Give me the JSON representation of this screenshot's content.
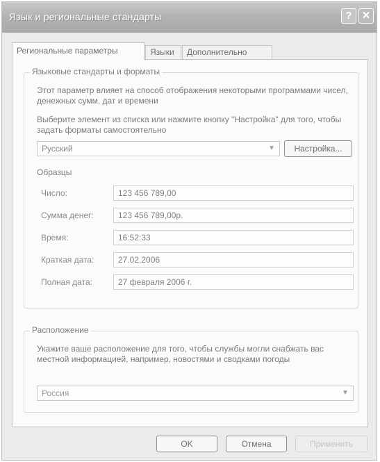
{
  "window": {
    "title": "Язык и региональные стандарты",
    "help_glyph": "?",
    "close_glyph": "✕"
  },
  "tabs": [
    {
      "label": "Региональные параметры"
    },
    {
      "label": "Языки"
    },
    {
      "label": "Дополнительно"
    }
  ],
  "standards": {
    "legend": "Языковые стандарты и форматы",
    "description": "Этот параметр влияет на способ отображения некоторыми программами чисел, денежных сумм, дат и времени",
    "instruction": "Выберите элемент из списка или нажмите кнопку \"Настройка\" для того, чтобы задать форматы самостоятельно",
    "selected_locale": "Русский",
    "customize_button": "Настройка..."
  },
  "samples": {
    "legend": "Образцы",
    "rows": [
      {
        "label": "Число:",
        "value": "123 456 789,00"
      },
      {
        "label": "Сумма денег:",
        "value": "123 456 789,00р."
      },
      {
        "label": "Время:",
        "value": "16:52:33"
      },
      {
        "label": "Краткая дата:",
        "value": "27.02.2006"
      },
      {
        "label": "Полная дата:",
        "value": "27 февраля 2006 г."
      }
    ]
  },
  "location": {
    "legend": "Расположение",
    "description": "Укажите ваше расположение для того, чтобы службы могли снабжать вас местной информацией, например, новостями и сводками погоды",
    "selected_location": "Россия"
  },
  "footer": {
    "ok_button": "OK",
    "cancel_button": "Отмена",
    "apply_button": "Применить"
  }
}
